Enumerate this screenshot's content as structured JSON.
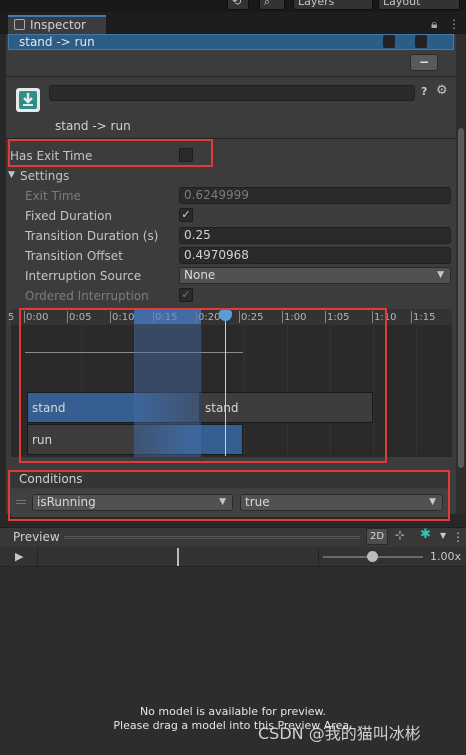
{
  "topbar": {
    "layers_label": "Layers",
    "layout_label": "Layout"
  },
  "tab": {
    "title": "Inspector"
  },
  "transition_row": {
    "label": "stand -> run"
  },
  "asset": {
    "name": "stand -> run"
  },
  "has_exit_time": {
    "label": "Has Exit Time",
    "checked": false
  },
  "settings": {
    "title": "Settings",
    "exit_time": {
      "label": "Exit Time",
      "value": "0.6249999"
    },
    "fixed_duration": {
      "label": "Fixed Duration",
      "checked": true
    },
    "transition_duration": {
      "label": "Transition Duration (s)",
      "value": "0.25"
    },
    "transition_offset": {
      "label": "Transition Offset",
      "value": "0.4970968"
    },
    "interruption_source": {
      "label": "Interruption Source",
      "value": "None"
    },
    "ordered_interruption": {
      "label": "Ordered Interruption",
      "checked": true
    }
  },
  "timeline": {
    "ticks": [
      "5",
      "0:00",
      "0:05",
      "0:10",
      "0:15",
      "0:20",
      "0:25",
      "1:00",
      "1:05",
      "1:10",
      "1:15"
    ],
    "bars": {
      "stand_1": "stand",
      "stand_2": "stand",
      "run": "run"
    }
  },
  "conditions": {
    "title": "Conditions",
    "param": "isRunning",
    "value": "true"
  },
  "preview": {
    "title": "Preview",
    "mode_2d": "2D",
    "speed": "1.00x",
    "message_line1": "No model is available for preview.",
    "message_line2": "Please drag a model into this Preview Area."
  },
  "watermark": "CSDN @我的猫叫冰彬",
  "colors": {
    "accent": "#3a79bb",
    "highlight": "#e03a3a",
    "selection": "#2c5d87",
    "keyframe": "#5b9bd9"
  }
}
